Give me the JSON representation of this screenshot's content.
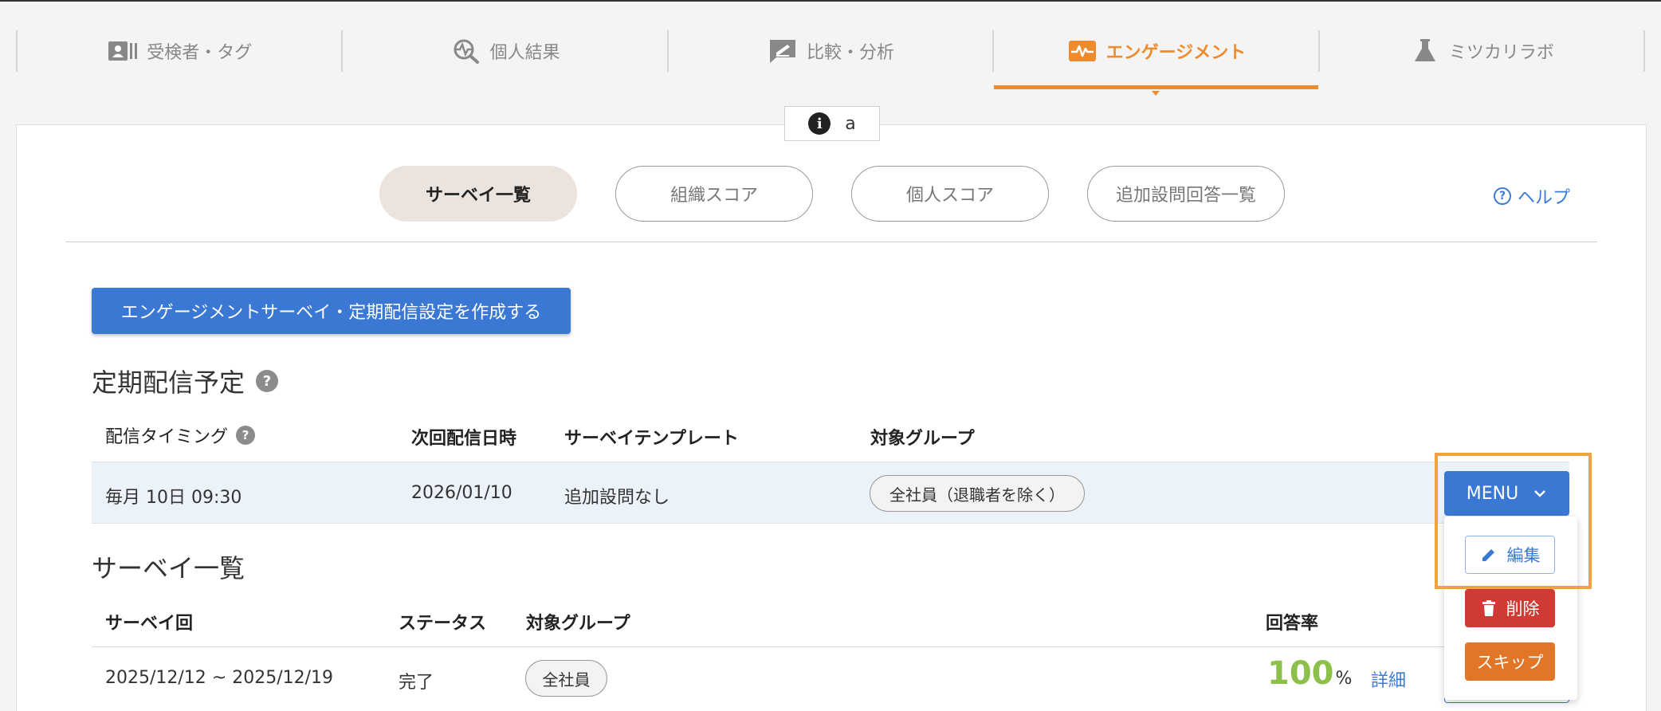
{
  "nav": {
    "tabs": [
      {
        "label": "受検者・タグ",
        "icon": "id-card-icon"
      },
      {
        "label": "個人結果",
        "icon": "search-pulse-icon"
      },
      {
        "label": "比較・分析",
        "icon": "edit-chat-icon"
      },
      {
        "label": "エンゲージメント",
        "icon": "heartbeat-icon",
        "active": true
      },
      {
        "label": "ミツカリラボ",
        "icon": "flask-icon"
      }
    ],
    "accent_color": "#ee8c2d"
  },
  "info_chip": {
    "icon": "i",
    "text": "a"
  },
  "subtabs": [
    "サーベイ一覧",
    "組織スコア",
    "個人スコア",
    "追加設問回答一覧"
  ],
  "help": {
    "icon": "?",
    "label": "ヘルプ"
  },
  "create_button": "エンゲージメントサーベイ・定期配信設定を作成する",
  "schedule": {
    "title": "定期配信予定",
    "title_icon": "?",
    "headers": {
      "timing": "配信タイミング",
      "timing_icon": "?",
      "next": "次回配信日時",
      "template": "サーベイテンプレート",
      "group": "対象グループ"
    },
    "row": {
      "timing": "毎月 10日 09:30",
      "next": "2026/01/10",
      "template": "追加設問なし",
      "group": "全社員（退職者を除く）"
    },
    "menu": {
      "label": "MENU",
      "chevron": "⌄",
      "items": {
        "edit": "編集",
        "delete": "削除",
        "skip": "スキップ"
      }
    }
  },
  "surveys": {
    "title": "サーベイ一覧",
    "headers": {
      "round": "サーベイ回",
      "status": "ステータス",
      "group": "対象グループ",
      "rate": "回答率"
    },
    "rows": [
      {
        "round": "2025/12/12 ~ 2025/12/19",
        "status": "完了",
        "group": "全社員",
        "rate": "100",
        "rate_unit": "%",
        "detail": "詳細"
      }
    ]
  }
}
